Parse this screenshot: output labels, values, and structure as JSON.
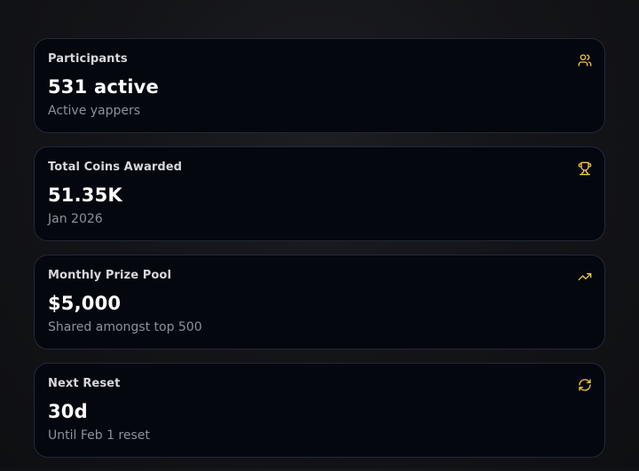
{
  "accent_color": "#f5c74a",
  "cards": [
    {
      "title": "Participants",
      "value": "531 active",
      "subtitle": "Active yappers",
      "icon": "users-icon"
    },
    {
      "title": "Total Coins Awarded",
      "value": "51.35K",
      "subtitle": "Jan 2026",
      "icon": "trophy-icon"
    },
    {
      "title": "Monthly Prize Pool",
      "value": "$5,000",
      "subtitle": "Shared amongst top 500",
      "icon": "trending-up-icon"
    },
    {
      "title": "Next Reset",
      "value": "30d",
      "subtitle": "Until Feb 1 reset",
      "icon": "refresh-icon"
    }
  ]
}
